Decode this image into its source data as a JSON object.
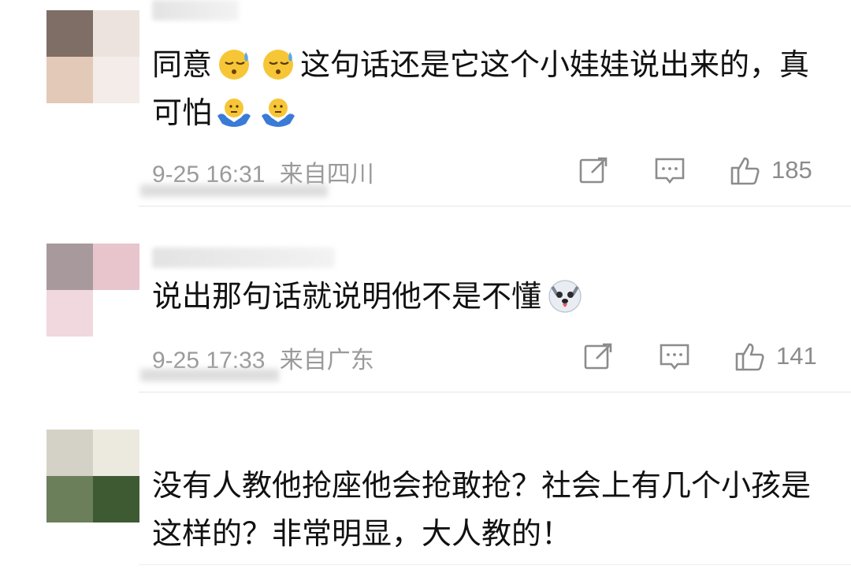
{
  "comments": [
    {
      "text_parts": [
        "同意",
        "这句话还是它这个小娃娃说出来的，真可怕"
      ],
      "emojis": [
        "sweat-emoji",
        "sweat-emoji",
        "shrug-emoji",
        "shrug-emoji"
      ],
      "time": "9-25 16:31",
      "location": "来自四川",
      "likes": "185"
    },
    {
      "text": "说出那句话就说明他不是不懂",
      "emojis": [
        "husky-emoji"
      ],
      "time": "9-25 17:33",
      "location": "来自广东",
      "likes": "141"
    },
    {
      "text": "没有人教他抢座他会抢敢抢？社会上有几个小孩是这样的？非常明显，大人教的！"
    }
  ],
  "icons": {
    "share": "share-icon",
    "reply": "comment-icon",
    "like": "thumbs-up-icon"
  },
  "colors": {
    "text": "#111111",
    "meta": "#9a9a9a",
    "divider": "#e6e6e6"
  }
}
